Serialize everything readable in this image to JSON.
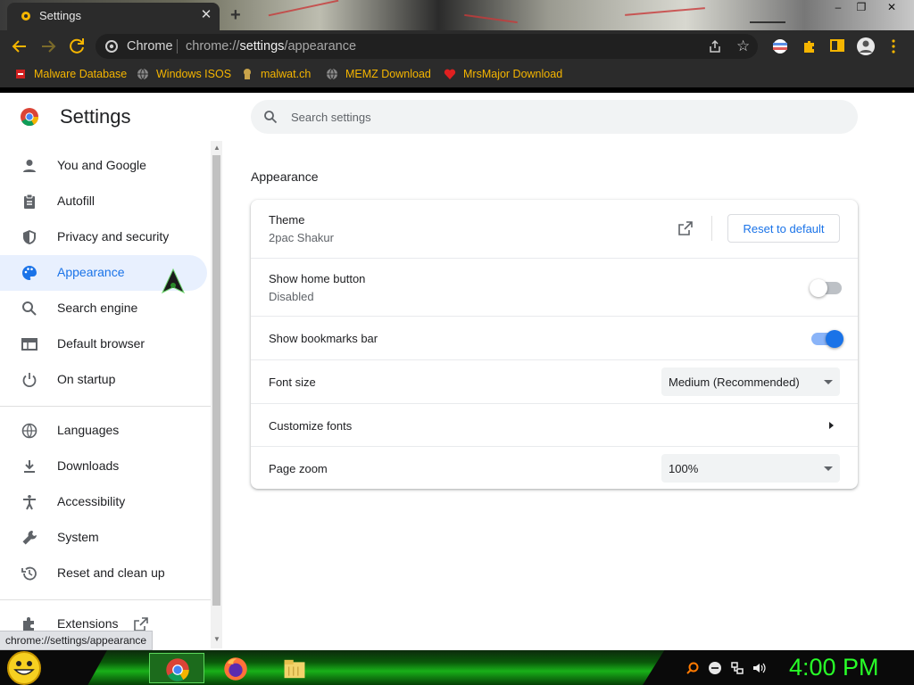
{
  "window": {
    "tab_title": "Settings",
    "tab_close": "✕",
    "new_tab": "+",
    "min": "–",
    "max": "❐",
    "close": "✕"
  },
  "toolbar": {
    "omnibox_label": "Chrome",
    "url_prefix": "chrome://",
    "url_host": "settings",
    "url_path": "/appearance"
  },
  "bookmarks": [
    {
      "label": "Malware Database",
      "icon": "malware-icon"
    },
    {
      "label": "Windows ISOS",
      "icon": "globe-icon"
    },
    {
      "label": "malwat.ch",
      "icon": "skull-icon"
    },
    {
      "label": "MEMZ Download",
      "icon": "globe-icon"
    },
    {
      "label": "MrsMajor Download",
      "icon": "heart-icon"
    }
  ],
  "settings": {
    "title": "Settings",
    "search_placeholder": "Search settings",
    "nav_group1": [
      {
        "label": "You and Google",
        "icon": "person-icon"
      },
      {
        "label": "Autofill",
        "icon": "clipboard-icon"
      },
      {
        "label": "Privacy and security",
        "icon": "shield-icon"
      },
      {
        "label": "Appearance",
        "icon": "palette-icon",
        "active": true
      },
      {
        "label": "Search engine",
        "icon": "search-icon"
      },
      {
        "label": "Default browser",
        "icon": "browser-icon"
      },
      {
        "label": "On startup",
        "icon": "power-icon"
      }
    ],
    "nav_group2": [
      {
        "label": "Languages",
        "icon": "globe-icon"
      },
      {
        "label": "Downloads",
        "icon": "download-icon"
      },
      {
        "label": "Accessibility",
        "icon": "accessibility-icon"
      },
      {
        "label": "System",
        "icon": "wrench-icon"
      },
      {
        "label": "Reset and clean up",
        "icon": "history-icon"
      }
    ],
    "nav_group3": [
      {
        "label": "Extensions",
        "icon": "puzzle-icon"
      }
    ]
  },
  "appearance": {
    "section_title": "Appearance",
    "theme_label": "Theme",
    "theme_value": "2pac Shakur",
    "reset_label": "Reset to default",
    "home_button_label": "Show home button",
    "home_button_sub": "Disabled",
    "home_button_on": false,
    "bookmarks_bar_label": "Show bookmarks bar",
    "bookmarks_bar_on": true,
    "font_size_label": "Font size",
    "font_size_value": "Medium (Recommended)",
    "customize_fonts_label": "Customize fonts",
    "page_zoom_label": "Page zoom",
    "page_zoom_value": "100%"
  },
  "status_bubble": "chrome://settings/appearance",
  "taskbar": {
    "clock": "4:00 PM",
    "apps": [
      "chrome-icon",
      "firefox-icon",
      "folder-icon"
    ]
  },
  "colors": {
    "accent": "#1a73e8",
    "active_nav_bg": "#e8f0fe",
    "bookmark_text": "#f5b500",
    "clock": "#28ff28"
  }
}
